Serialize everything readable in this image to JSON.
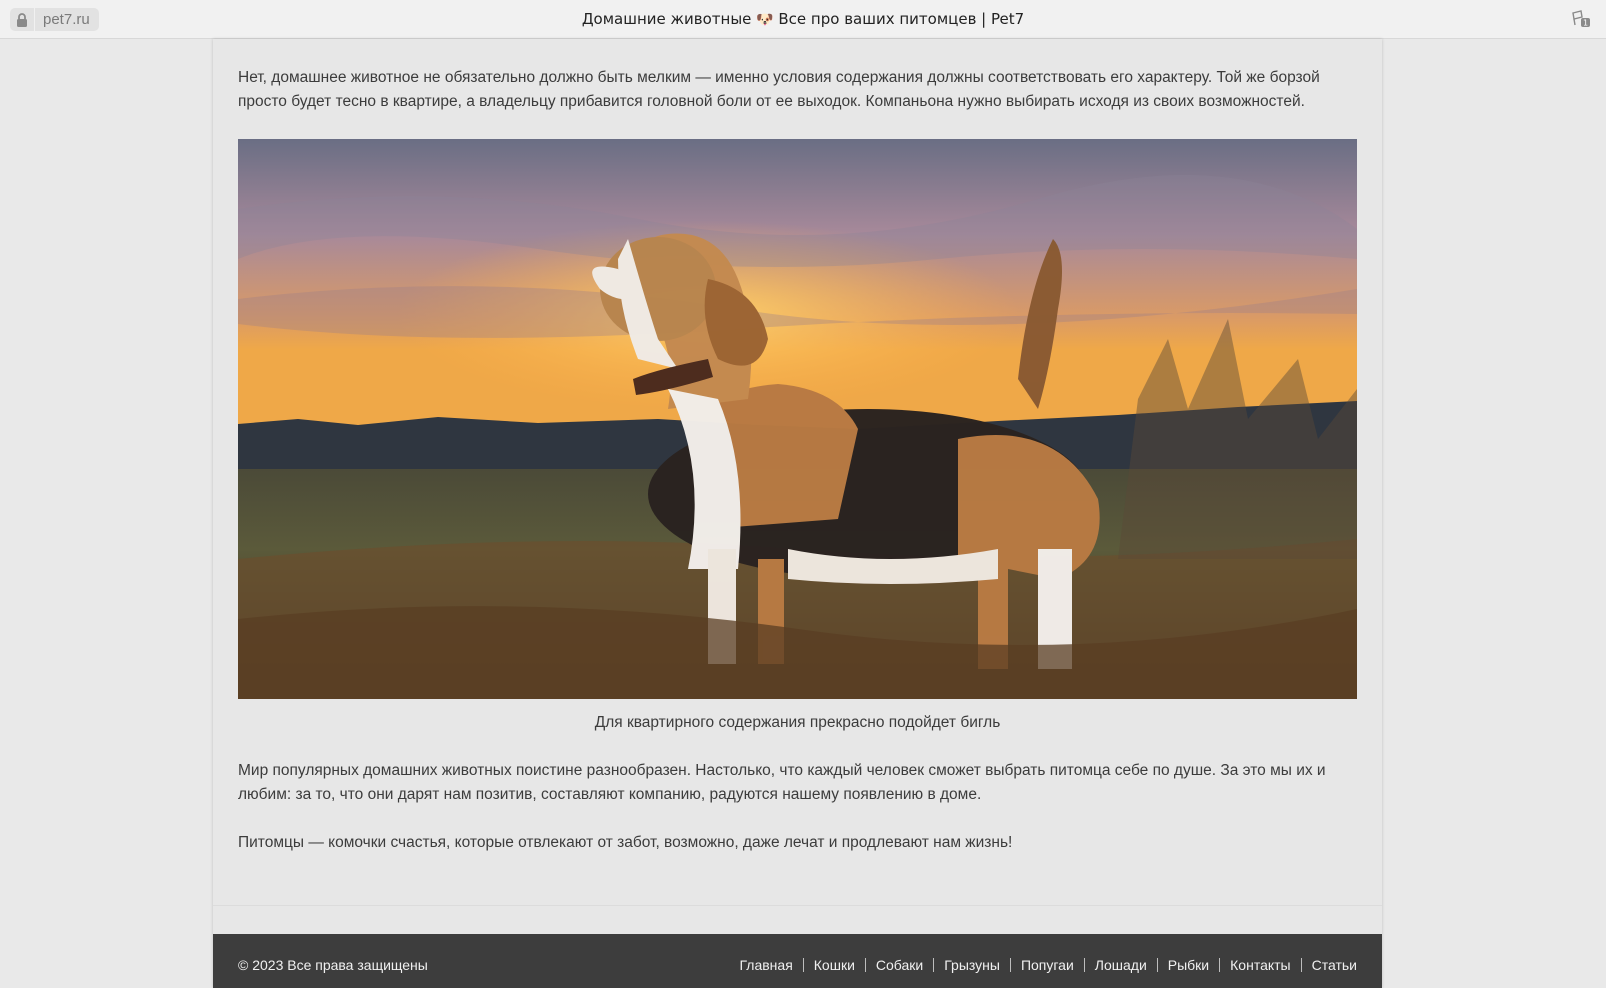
{
  "browser": {
    "url": "pet7.ru",
    "title_part1": "Домашние животные",
    "title_emoji": "🐶",
    "title_part2": "Все про ваших питомцев | Pet7",
    "extension_badge": "1"
  },
  "article": {
    "paragraph_1": "Нет, домашнее животное не обязательно должно быть мелким — именно условия содержания должны соответствовать его характеру. Той же борзой просто будет тесно в квартире, а владельцу прибавится головной боли от ее выходок. Компаньона нужно выбирать исходя из своих возможностей.",
    "image_caption": "Для квартирного содержания прекрасно подойдет бигль",
    "paragraph_2": "Мир популярных домашних животных поистине разнообразен. Настолько, что каждый человек сможет выбрать питомца себе по душе. За это мы их и любим: за то, что они дарят нам позитив, составляют компанию, радуются нашему появлению в доме.",
    "paragraph_3": "Питомцы — комочки счастья, которые отвлекают от забот, возможно, даже лечат и продлевают нам жизнь!"
  },
  "footer": {
    "copyright": "© 2023 Все права защищены",
    "nav": [
      "Главная",
      "Кошки",
      "Собаки",
      "Грызуны",
      "Попугаи",
      "Лошади",
      "Рыбки",
      "Контакты",
      "Статьи"
    ]
  },
  "colors": {
    "page_bg": "#e7e7e7",
    "footer_bg": "#3d3d3d",
    "text": "#3c3c3c"
  }
}
